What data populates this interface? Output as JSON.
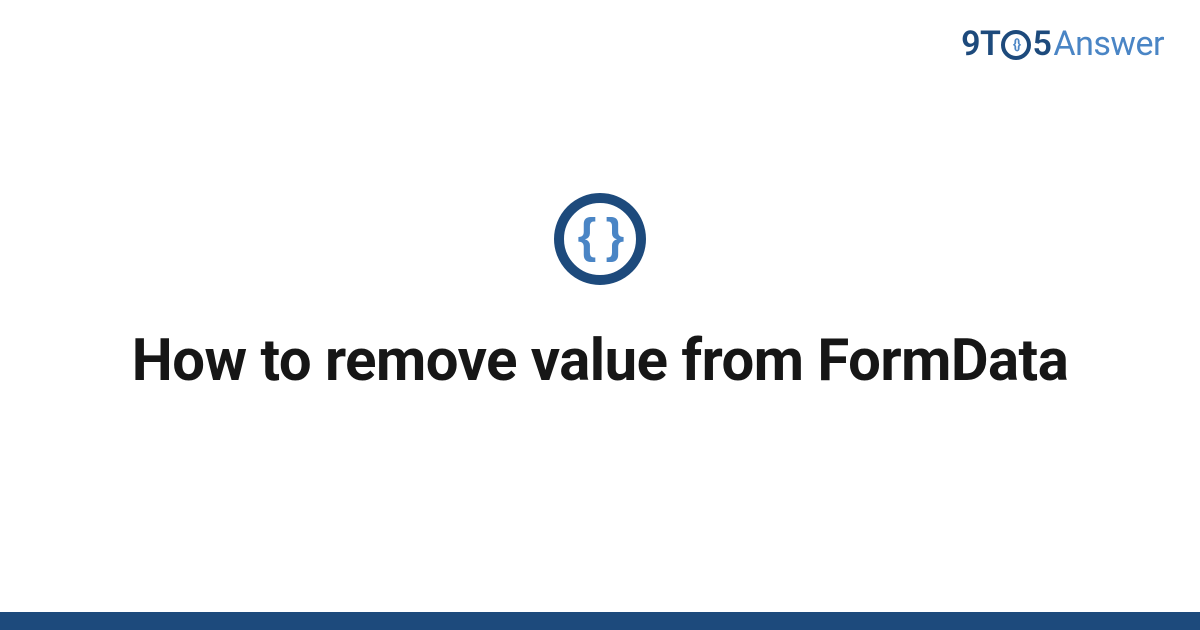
{
  "logo": {
    "part_9t": "9T",
    "ring_inner": "{}",
    "part_5": "5",
    "part_answer": "Answer"
  },
  "badge": {
    "symbol": "{ }"
  },
  "title": "How to remove value from FormData",
  "colors": {
    "primary_dark": "#1d4a7c",
    "primary_light": "#4a85c5",
    "text": "#161616",
    "background": "#ffffff"
  }
}
